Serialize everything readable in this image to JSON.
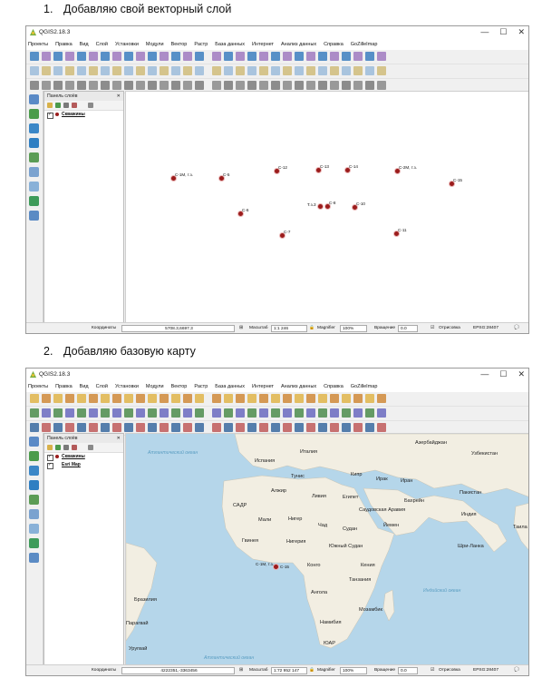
{
  "steps": [
    {
      "number": "1.",
      "text": "Добавляю свой векторный слой"
    },
    {
      "number": "2.",
      "text": "Добавляю базовую карту"
    }
  ],
  "window": {
    "title": "QGIS2.18.3",
    "menu": [
      "Проекты",
      "Правка",
      "Вид",
      "Слой",
      "Установки",
      "Модули",
      "Вектор",
      "Растр",
      "База данных",
      "Интернет",
      "Анализ данных",
      "Справка",
      "GoZilleImap"
    ],
    "controls": [
      "—",
      "☐",
      "✕"
    ]
  },
  "layers_panel": {
    "title": "Панель слоёв"
  },
  "screen1": {
    "layers": [
      {
        "name": "Скважины",
        "checked": true
      }
    ],
    "wells": [
      {
        "label": "С-1М, т.з."
      },
      {
        "label": "С-5"
      },
      {
        "label": "С-12"
      },
      {
        "label": "С-13"
      },
      {
        "label": "С-14"
      },
      {
        "label": "С-2М, т.з."
      },
      {
        "label": "С-15"
      },
      {
        "label": "Т.з.3"
      },
      {
        "label": "С-8"
      },
      {
        "label": "С-10"
      },
      {
        "label": "С-6"
      },
      {
        "label": "С-7"
      },
      {
        "label": "С-11"
      }
    ],
    "status": {
      "coord_label": "Координаты",
      "coord_value": "5708.3,6697.3",
      "scale_label": "Масштаб",
      "scale_value": "1:1 246",
      "magnifier_label": "Magnifier",
      "magnifier_value": "100%",
      "rotation_label": "Вращение",
      "rotation_value": "0.0",
      "render_label": "Отрисовка",
      "epsg": "EPSG:28407"
    }
  },
  "screen2": {
    "layers": [
      {
        "name": "Скважины",
        "checked": true
      },
      {
        "name": "Esri Map",
        "checked": true
      }
    ],
    "places": [
      "Италия",
      "Испания",
      "Азербайджан",
      "Узбекистан",
      "Тунис",
      "Кипр",
      "Ирак",
      "Иран",
      "Алжир",
      "Ливия",
      "Египет",
      "Бахрейн",
      "Пакистан",
      "САДР",
      "Саудовская Аравия",
      "Индия",
      "Мали",
      "Нигер",
      "Чад",
      "Судан",
      "Йемен",
      "Гвинея",
      "Нигерия",
      "Южный Судан",
      "Шри-Ланка",
      "Конго",
      "Кения",
      "Танзания",
      "Ангола",
      "Мозамбик",
      "Бразилия",
      "Намибия",
      "ЮАР",
      "Парагвай",
      "Уругвай",
      "Таила"
    ],
    "seas": [
      "Атлантический океан",
      "Индийский океан",
      "Атлантический океан"
    ],
    "well_label": "С-1М, т.з.",
    "well_label2": "С-15",
    "status": {
      "coord_label": "Координаты",
      "coord_value": "4222351,-3363456",
      "scale_label": "Масштаб",
      "scale_value": "1:72 952 147",
      "magnifier_label": "Magnifier",
      "magnifier_value": "100%",
      "rotation_label": "Вращение",
      "rotation_value": "0.0",
      "render_label": "Отрисовка",
      "epsg": "EPSG:28407"
    }
  }
}
